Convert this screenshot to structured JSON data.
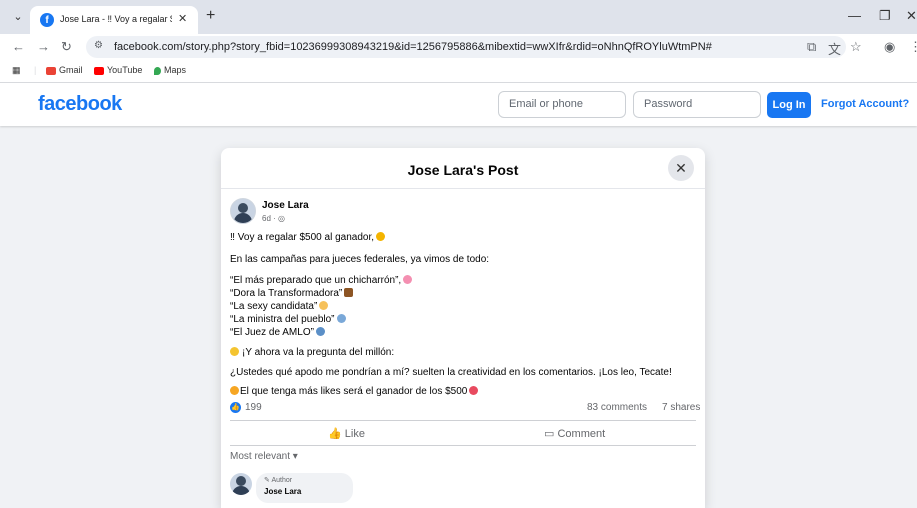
{
  "browser": {
    "tab_title": "Jose Lara - ‼ Voy a regalar $500",
    "url": "facebook.com/story.php?story_fbid=10236999308943219&id=1256795886&mibextid=wwXIfr&rdid=oNhnQfROYluWtmPN#",
    "bookmarks": [
      "Gmail",
      "YouTube",
      "Maps"
    ]
  },
  "fb": {
    "logo": "facebook",
    "email_placeholder": "Email or phone",
    "password_placeholder": "Password",
    "login": "Log In",
    "forgot": "Forgot Account?"
  },
  "post": {
    "modal_title": "Jose Lara's Post",
    "author": "Jose Lara",
    "time": "6d · ",
    "lines": [
      "‼ Voy a regalar $500 al ganador,",
      "En las campañas para jueces federales, ya vimos de todo:",
      "“El más preparado que un chicharrón”,",
      "“Dora la Transformadora”",
      "“La sexy candidata”",
      "“La ministra del pueblo”",
      "“El Juez de AMLO”",
      "¡Y ahora va la pregunta del millón:",
      "¿Ustedes qué apodo me pondrían a mí? suelten la creatividad en los comentarios. ¡Los leo, Tecate!",
      "El que tenga más likes será el ganador de los $500"
    ],
    "reactions": "199",
    "comments": "83 comments",
    "shares": "7 shares",
    "like": "Like",
    "comment": "Comment",
    "sort": "Most relevant ▾",
    "comment_tag": "Author",
    "comment_name": "Jose Lara"
  },
  "colors": {
    "fb_blue": "#1877f2",
    "bg": "#f0f2f5"
  }
}
